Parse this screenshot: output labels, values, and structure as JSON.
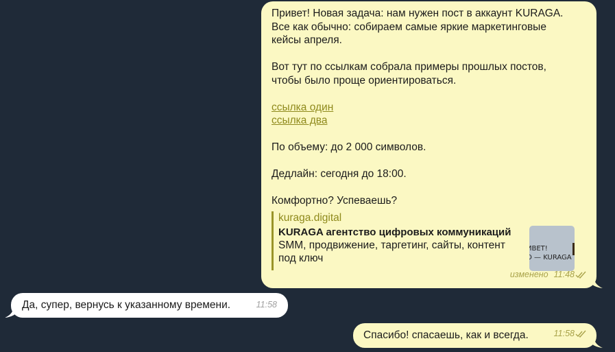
{
  "messages": {
    "m1": {
      "line1": "Привет! Новая задача: нам нужен пост в аккаунт KURAGA.",
      "line2": "Все как обычно: собираем самые яркие маркетинговые",
      "line3": "кейсы апреля.",
      "line4": "Вот тут по ссылкам собрала примеры прошлых постов,",
      "line5": "чтобы было проще ориентироваться.",
      "link1": "ссылка один",
      "link2": "ссылка два",
      "volume": "По объему:  до 2 000 символов.",
      "deadline": "Дедлайн: сегодня до 18:00.",
      "question": "Комфортно? Успеваешь?",
      "preview": {
        "site": "kuraga.digital",
        "title": "KURAGA агентство цифровых коммуникаций",
        "desc_line1": "SMM, продвижение, таргетинг, сайты, контент",
        "desc_line2": "под ключ",
        "thumb_line1": "ИВЕТ!",
        "thumb_line2": "О — KURAGA"
      },
      "edited_label": "изменено",
      "time": "11:48"
    },
    "m2": {
      "text": "Да, супер, вернусь к указанному времени.",
      "time": "11:58"
    },
    "m3": {
      "text": "Спасибо! спасаешь, как и всегда.",
      "time": "11:58"
    }
  },
  "colors": {
    "background": "#1f2a38",
    "outgoing_bubble": "#fbf8c3",
    "incoming_bubble": "#ffffff",
    "accent": "#8f8a1c"
  }
}
